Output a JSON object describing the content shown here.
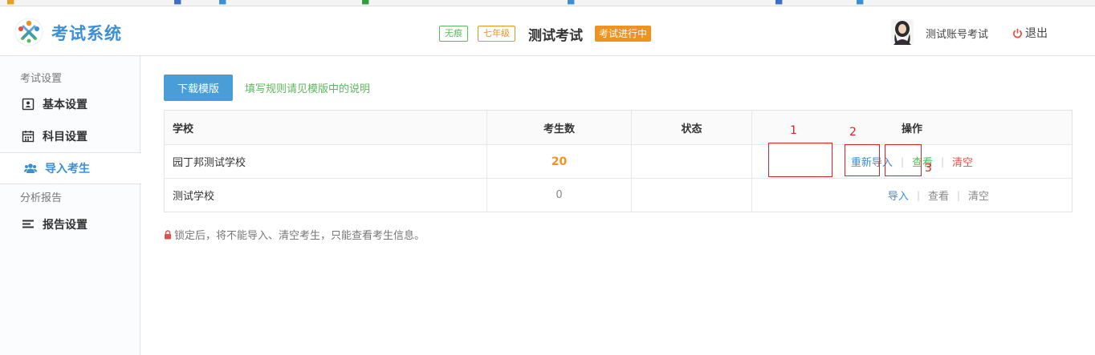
{
  "header": {
    "app_title": "考试系统",
    "tags": [
      "无痕",
      "七年级"
    ],
    "exam_name": "测试考试",
    "exam_status": "考试进行中",
    "user_name": "测试账号考试",
    "logout_label": "退出"
  },
  "sidebar": {
    "group1_title": "考试设置",
    "items": [
      {
        "label": "基本设置",
        "icon": "id-card-icon"
      },
      {
        "label": "科目设置",
        "icon": "calendar-icon"
      },
      {
        "label": "导入考生",
        "icon": "users-icon",
        "active": true
      }
    ],
    "group2_title": "分析报告",
    "items2": [
      {
        "label": "报告设置",
        "icon": "list-icon"
      }
    ]
  },
  "main": {
    "download_label": "下载模版",
    "hint": "填写规则请见模版中的说明",
    "columns": [
      "学校",
      "考生数",
      "状态",
      "操作"
    ],
    "rows": [
      {
        "school": "园丁邦测试学校",
        "count": "20",
        "status": "",
        "ops": [
          "重新导入",
          "查看",
          "清空"
        ]
      },
      {
        "school": "测试学校",
        "count": "0",
        "status": "",
        "ops": [
          "导入",
          "查看",
          "清空"
        ]
      }
    ],
    "annotations": [
      "1",
      "2",
      "3"
    ],
    "lock_note": "锁定后，将不能导入、清空考生，只能查看考生信息。"
  }
}
